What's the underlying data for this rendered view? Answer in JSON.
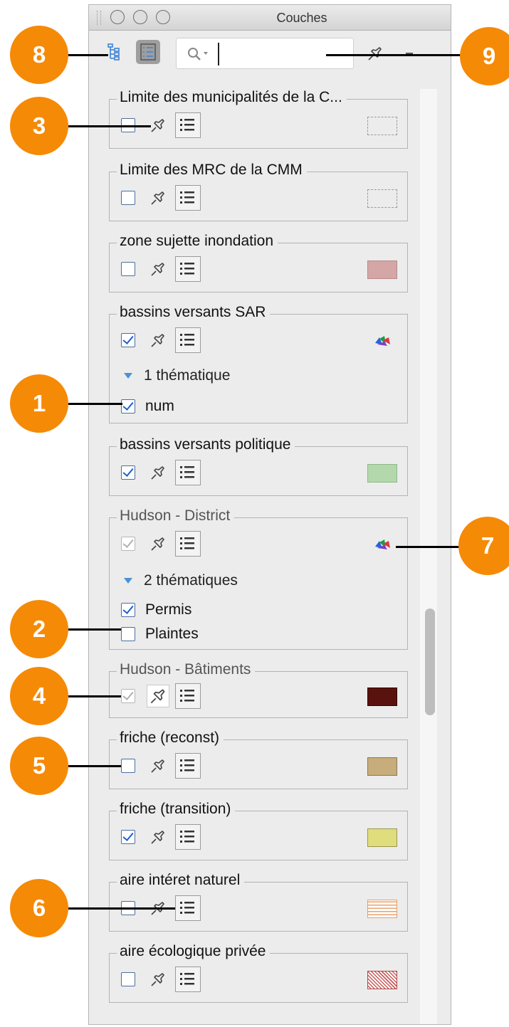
{
  "window": {
    "title": "Couches"
  },
  "toolbar": {
    "search_placeholder": "",
    "tree_view_icon": "tree-view-icon",
    "list_view_icon": "list-view-icon",
    "pin_icon": "pin-icon"
  },
  "layers": [
    {
      "title": "Limite des municipalités de la C...",
      "checked": false,
      "swatch": "dashed-outline"
    },
    {
      "title": "Limite des MRC de la CMM",
      "checked": false,
      "swatch": "dashed-outline"
    },
    {
      "title": "zone sujette inondation",
      "checked": false,
      "swatch": "#d4a6a6"
    },
    {
      "title": "bassins versants SAR",
      "checked": true,
      "swatch": "thematic-icon",
      "thematic_label": "1 thématique",
      "themes": [
        {
          "label": "num",
          "checked": true
        }
      ]
    },
    {
      "title": "bassins versants politique",
      "checked": true,
      "swatch": "#b3d8ac"
    },
    {
      "title": "Hudson - District",
      "checked": true,
      "disabled": true,
      "swatch": "thematic-icon",
      "thematic_label": "2 thématiques",
      "themes": [
        {
          "label": "Permis",
          "checked": true
        },
        {
          "label": "Plaintes",
          "checked": false
        }
      ]
    },
    {
      "title": "Hudson - Bâtiments",
      "checked": true,
      "disabled": true,
      "swatch": "#5a120e"
    },
    {
      "title": "friche (reconst)",
      "checked": false,
      "swatch": "#c7ac7c"
    },
    {
      "title": "friche (transition)",
      "checked": true,
      "swatch": "#dfdd7c"
    },
    {
      "title": "aire intéret naturel",
      "checked": false,
      "swatch": "orange-stripes"
    },
    {
      "title": "aire écologique privée",
      "checked": false,
      "swatch": "red-hatch"
    }
  ],
  "callouts": [
    "1",
    "2",
    "3",
    "4",
    "5",
    "6",
    "7",
    "8",
    "9"
  ],
  "colors": {
    "callout": "#f58a07",
    "check": "#1d5fd0",
    "thematic_arrow": "#4a90d9"
  }
}
